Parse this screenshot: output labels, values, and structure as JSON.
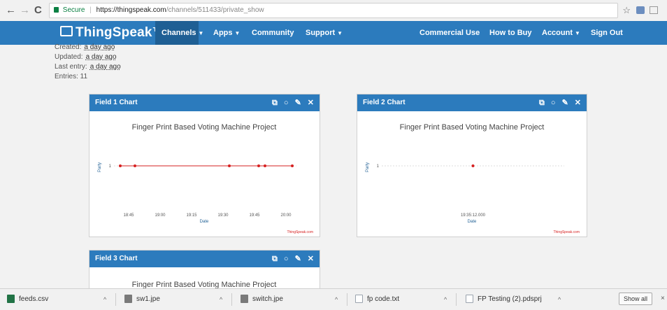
{
  "browser": {
    "back": "←",
    "forward": "→",
    "reload": "C",
    "secure_label": "Secure",
    "url_host": "https://thingspeak.com",
    "url_path": "/channels/511433/private_show",
    "star": "☆"
  },
  "nav": {
    "brand": "ThingSpeak™",
    "items": [
      "Channels",
      "Apps",
      "Community",
      "Support"
    ],
    "right_items": [
      "Commercial Use",
      "How to Buy",
      "Account",
      "Sign Out"
    ]
  },
  "info": {
    "created_label": "Created:",
    "created_value": "a day ago",
    "updated_label": "Updated:",
    "updated_value": "a day ago",
    "last_entry_label": "Last entry:",
    "last_entry_value": "a day ago",
    "entries": "Entries: 11"
  },
  "panels": [
    {
      "header": "Field 1 Chart",
      "title": "Finger Print Based Voting Machine Project",
      "xlabel": "Date",
      "ylabel": "Party",
      "credit": "ThingSpeak.com"
    },
    {
      "header": "Field 2 Chart",
      "title": "Finger Print Based Voting Machine Project",
      "xlabel": "Date",
      "ylabel": "Party",
      "credit": "ThingSpeak.com"
    },
    {
      "header": "Field 3 Chart",
      "title": "Finger Print Based Voting Machine Project"
    }
  ],
  "chart_data": [
    {
      "type": "line",
      "title": "Finger Print Based Voting Machine Project",
      "xlabel": "Date",
      "ylabel": "Party",
      "x_ticks": [
        "18:45",
        "19:00",
        "19:15",
        "19:30",
        "19:45",
        "20:00"
      ],
      "y_ticks": [
        "1"
      ],
      "series": [
        {
          "x": [
            "18:41",
            "18:48",
            "19:33",
            "19:47",
            "19:50",
            "20:03"
          ],
          "y": [
            1,
            1,
            1,
            1,
            1,
            1
          ],
          "color": "#d62020"
        }
      ]
    },
    {
      "type": "scatter",
      "title": "Finger Print Based Voting Machine Project",
      "xlabel": "Date",
      "ylabel": "Party",
      "x_ticks": [
        "19:35:12.000"
      ],
      "y_ticks": [
        "1"
      ],
      "series": [
        {
          "x": [
            "19:35:12.000"
          ],
          "y": [
            1
          ],
          "color": "#d62020"
        }
      ]
    }
  ],
  "downloads": [
    {
      "name": "feeds.csv",
      "color": "#217346"
    },
    {
      "name": "sw1.jpe",
      "color": "#7a7a7a"
    },
    {
      "name": "switch.jpe",
      "color": "#7a7a7a"
    },
    {
      "name": "fp code.txt",
      "color": "#9aa3ad"
    },
    {
      "name": "FP Testing (2).pdsprj",
      "color": "#9aa3ad"
    }
  ],
  "show_all": "Show all",
  "close": "×"
}
